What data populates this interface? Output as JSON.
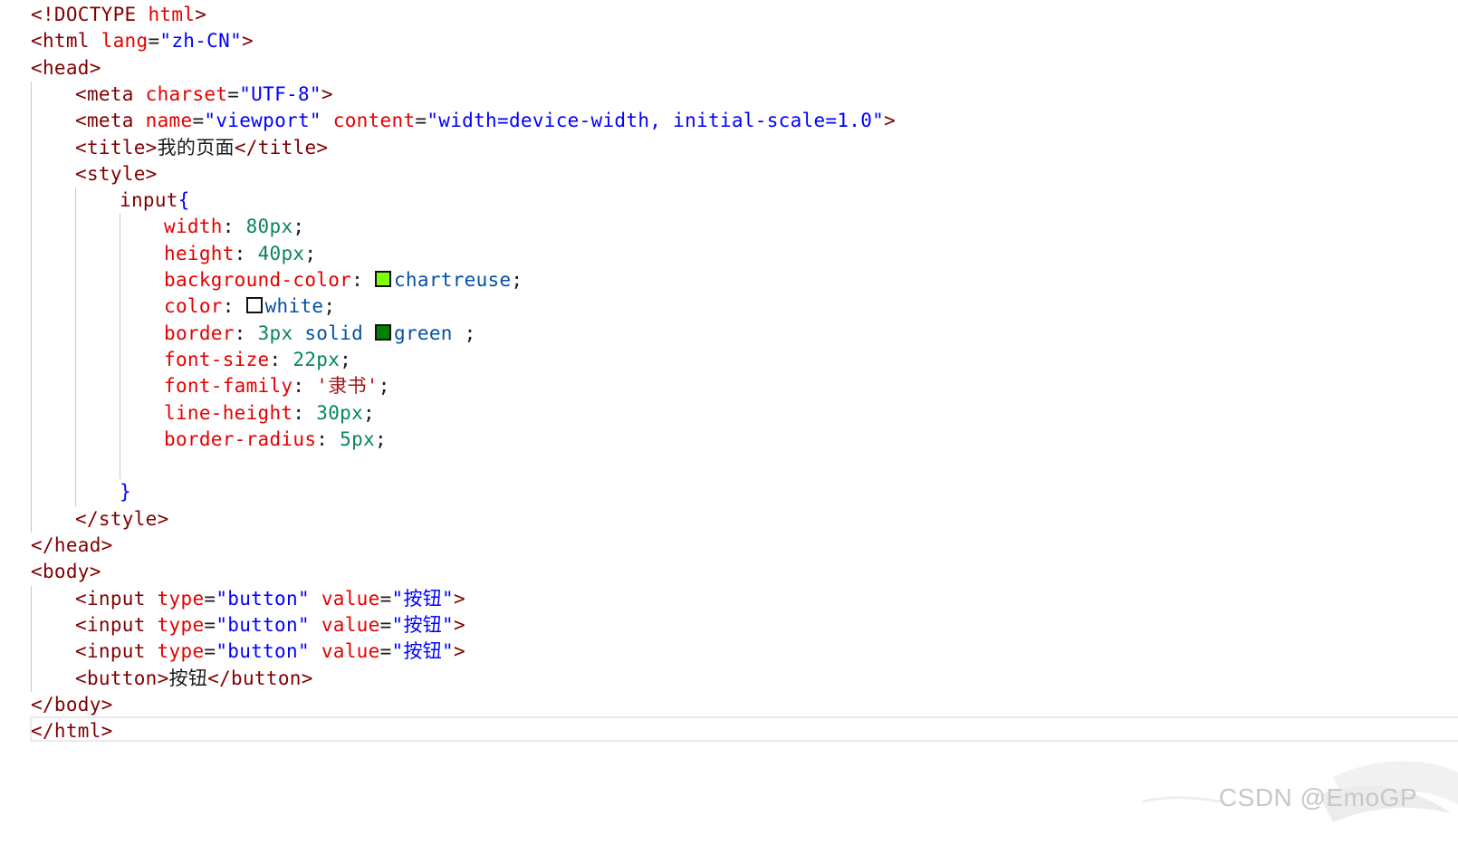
{
  "editor": {
    "lines": [
      {
        "indent": 0,
        "tokens": [
          {
            "c": "t-tag",
            "t": "<!DOCTYPE "
          },
          {
            "c": "t-attr",
            "t": "html"
          },
          {
            "c": "t-tag",
            "t": ">"
          }
        ]
      },
      {
        "indent": 0,
        "tokens": [
          {
            "c": "t-tag",
            "t": "<html "
          },
          {
            "c": "t-attr",
            "t": "lang"
          },
          {
            "c": "t-plain",
            "t": "="
          },
          {
            "c": "t-str",
            "t": "\"zh-CN\""
          },
          {
            "c": "t-tag",
            "t": ">"
          }
        ]
      },
      {
        "indent": 0,
        "tokens": [
          {
            "c": "t-tag",
            "t": "<head>"
          }
        ]
      },
      {
        "indent": 1,
        "tokens": [
          {
            "c": "t-tag",
            "t": "<meta "
          },
          {
            "c": "t-attr",
            "t": "charset"
          },
          {
            "c": "t-plain",
            "t": "="
          },
          {
            "c": "t-str",
            "t": "\"UTF-8\""
          },
          {
            "c": "t-tag",
            "t": ">"
          }
        ]
      },
      {
        "indent": 1,
        "tokens": [
          {
            "c": "t-tag",
            "t": "<meta "
          },
          {
            "c": "t-attr",
            "t": "name"
          },
          {
            "c": "t-plain",
            "t": "="
          },
          {
            "c": "t-str",
            "t": "\"viewport\" "
          },
          {
            "c": "t-attr",
            "t": "content"
          },
          {
            "c": "t-plain",
            "t": "="
          },
          {
            "c": "t-str",
            "t": "\"width=device-width, initial-scale=1.0\""
          },
          {
            "c": "t-tag",
            "t": ">"
          }
        ]
      },
      {
        "indent": 1,
        "tokens": [
          {
            "c": "t-tag",
            "t": "<title>"
          },
          {
            "c": "t-plain",
            "t": "我的页面"
          },
          {
            "c": "t-tag",
            "t": "</title>"
          }
        ]
      },
      {
        "indent": 1,
        "tokens": [
          {
            "c": "t-tag",
            "t": "<style>"
          }
        ]
      },
      {
        "indent": 2,
        "tokens": [
          {
            "c": "t-sel",
            "t": "input"
          },
          {
            "c": "t-brace",
            "t": "{"
          }
        ]
      },
      {
        "indent": 3,
        "tokens": [
          {
            "c": "t-prop",
            "t": "width"
          },
          {
            "c": "t-plain",
            "t": ": "
          },
          {
            "c": "t-num",
            "t": "80px"
          },
          {
            "c": "t-plain",
            "t": ";"
          }
        ]
      },
      {
        "indent": 3,
        "tokens": [
          {
            "c": "t-prop",
            "t": "height"
          },
          {
            "c": "t-plain",
            "t": ": "
          },
          {
            "c": "t-num",
            "t": "40px"
          },
          {
            "c": "t-plain",
            "t": ";"
          }
        ]
      },
      {
        "indent": 3,
        "tokens": [
          {
            "c": "t-prop",
            "t": "background-color"
          },
          {
            "c": "t-plain",
            "t": ": "
          },
          {
            "c": "swatch",
            "color": "#7fff00"
          },
          {
            "c": "t-kw",
            "t": "chartreuse"
          },
          {
            "c": "t-plain",
            "t": ";"
          }
        ]
      },
      {
        "indent": 3,
        "tokens": [
          {
            "c": "t-prop",
            "t": "color"
          },
          {
            "c": "t-plain",
            "t": ": "
          },
          {
            "c": "swatch",
            "color": "#ffffff"
          },
          {
            "c": "t-kw",
            "t": "white"
          },
          {
            "c": "t-plain",
            "t": ";"
          }
        ]
      },
      {
        "indent": 3,
        "tokens": [
          {
            "c": "t-prop",
            "t": "border"
          },
          {
            "c": "t-plain",
            "t": ": "
          },
          {
            "c": "t-num",
            "t": "3px "
          },
          {
            "c": "t-kw",
            "t": "solid "
          },
          {
            "c": "swatch",
            "color": "#008000"
          },
          {
            "c": "t-kw",
            "t": "green"
          },
          {
            "c": "t-plain",
            "t": " ;"
          }
        ]
      },
      {
        "indent": 3,
        "tokens": [
          {
            "c": "t-prop",
            "t": "font-size"
          },
          {
            "c": "t-plain",
            "t": ": "
          },
          {
            "c": "t-num",
            "t": "22px"
          },
          {
            "c": "t-plain",
            "t": ";"
          }
        ]
      },
      {
        "indent": 3,
        "tokens": [
          {
            "c": "t-prop",
            "t": "font-family"
          },
          {
            "c": "t-plain",
            "t": ": "
          },
          {
            "c": "t-cjkstr",
            "t": "'隶书'"
          },
          {
            "c": "t-plain",
            "t": ";"
          }
        ]
      },
      {
        "indent": 3,
        "tokens": [
          {
            "c": "t-prop",
            "t": "line-height"
          },
          {
            "c": "t-plain",
            "t": ": "
          },
          {
            "c": "t-num",
            "t": "30px"
          },
          {
            "c": "t-plain",
            "t": ";"
          }
        ]
      },
      {
        "indent": 3,
        "tokens": [
          {
            "c": "t-prop",
            "t": "border-radius"
          },
          {
            "c": "t-plain",
            "t": ": "
          },
          {
            "c": "t-num",
            "t": "5px"
          },
          {
            "c": "t-plain",
            "t": ";"
          }
        ]
      },
      {
        "indent": 3,
        "tokens": []
      },
      {
        "indent": 2,
        "tokens": [
          {
            "c": "t-brace",
            "t": "}"
          }
        ]
      },
      {
        "indent": 1,
        "tokens": [
          {
            "c": "t-tag",
            "t": "</style>"
          }
        ]
      },
      {
        "indent": 0,
        "tokens": [
          {
            "c": "t-tag",
            "t": "</head>"
          }
        ]
      },
      {
        "indent": 0,
        "tokens": [
          {
            "c": "t-tag",
            "t": "<body>"
          }
        ]
      },
      {
        "indent": 1,
        "tokens": [
          {
            "c": "t-tag",
            "t": "<input "
          },
          {
            "c": "t-attr",
            "t": "type"
          },
          {
            "c": "t-plain",
            "t": "="
          },
          {
            "c": "t-str",
            "t": "\"button\" "
          },
          {
            "c": "t-attr",
            "t": "value"
          },
          {
            "c": "t-plain",
            "t": "="
          },
          {
            "c": "t-str",
            "t": "\"按钮\""
          },
          {
            "c": "t-tag",
            "t": ">"
          }
        ]
      },
      {
        "indent": 1,
        "tokens": [
          {
            "c": "t-tag",
            "t": "<input "
          },
          {
            "c": "t-attr",
            "t": "type"
          },
          {
            "c": "t-plain",
            "t": "="
          },
          {
            "c": "t-str",
            "t": "\"button\" "
          },
          {
            "c": "t-attr",
            "t": "value"
          },
          {
            "c": "t-plain",
            "t": "="
          },
          {
            "c": "t-str",
            "t": "\"按钮\""
          },
          {
            "c": "t-tag",
            "t": ">"
          }
        ]
      },
      {
        "indent": 1,
        "tokens": [
          {
            "c": "t-tag",
            "t": "<input "
          },
          {
            "c": "t-attr",
            "t": "type"
          },
          {
            "c": "t-plain",
            "t": "="
          },
          {
            "c": "t-str",
            "t": "\"button\" "
          },
          {
            "c": "t-attr",
            "t": "value"
          },
          {
            "c": "t-plain",
            "t": "="
          },
          {
            "c": "t-str",
            "t": "\"按钮\""
          },
          {
            "c": "t-tag",
            "t": ">"
          }
        ]
      },
      {
        "indent": 1,
        "tokens": [
          {
            "c": "t-tag",
            "t": "<button>"
          },
          {
            "c": "t-plain",
            "t": "按钮"
          },
          {
            "c": "t-tag",
            "t": "</button>"
          }
        ]
      },
      {
        "indent": 0,
        "tokens": [
          {
            "c": "t-tag",
            "t": "</body>"
          }
        ]
      },
      {
        "indent": 0,
        "tokens": [
          {
            "c": "t-tag",
            "t": "</html>"
          }
        ]
      }
    ]
  },
  "watermark": {
    "text": "CSDN @EmoGP"
  },
  "colors": {
    "tag": "#800000",
    "attribute": "#e50000",
    "string": "#0000ff",
    "number": "#098658",
    "keyword": "#0451a5",
    "chartreuse_swatch": "#7fff00",
    "white_swatch": "#ffffff",
    "green_swatch": "#008000"
  }
}
